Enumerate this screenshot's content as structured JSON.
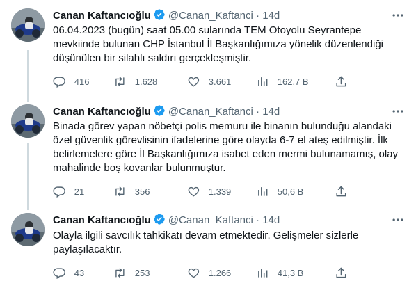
{
  "tweets": [
    {
      "name": "Canan Kaftancıoğlu",
      "handle": "@Canan_Kaftanci",
      "separator": "·",
      "time": "14d",
      "text": "06.04.2023 (bugün) saat 05.00 sularında TEM Otoyolu Seyrantepe mevkiinde bulunan CHP İstanbul İl Başkanlığımıza yönelik düzenlendiği düşünülen bir silahlı saldırı gerçekleşmiştir.",
      "replies": "416",
      "retweets": "1.628",
      "likes": "3.661",
      "views": "162,7 B"
    },
    {
      "name": "Canan Kaftancıoğlu",
      "handle": "@Canan_Kaftanci",
      "separator": "·",
      "time": "14d",
      "text": "Binada görev yapan nöbetçi polis memuru ile binanın bulunduğu alandaki özel güvenlik görevlisinin ifadelerine göre olayda 6-7 el ateş edilmiştir. İlk belirlemelere göre İl Başkanlığımıza isabet eden mermi bulunamamış, olay mahalinde boş kovanlar bulunmuştur.",
      "replies": "21",
      "retweets": "356",
      "likes": "1.339",
      "views": "50,6 B"
    },
    {
      "name": "Canan Kaftancıoğlu",
      "handle": "@Canan_Kaftanci",
      "separator": "·",
      "time": "14d",
      "text": "Olayla ilgili savcılık tahkikatı devam etmektedir. Gelişmeler sizlerle paylaşılacaktır.",
      "replies": "43",
      "retweets": "253",
      "likes": "1.266",
      "views": "41,3 B"
    }
  ],
  "colors": {
    "verified": "#1d9bf0",
    "muted": "#536471",
    "thread_line": "#cfd9de"
  },
  "icons": [
    "verified-badge-icon",
    "more-icon",
    "reply-icon",
    "retweet-icon",
    "like-icon",
    "views-icon",
    "share-icon"
  ]
}
